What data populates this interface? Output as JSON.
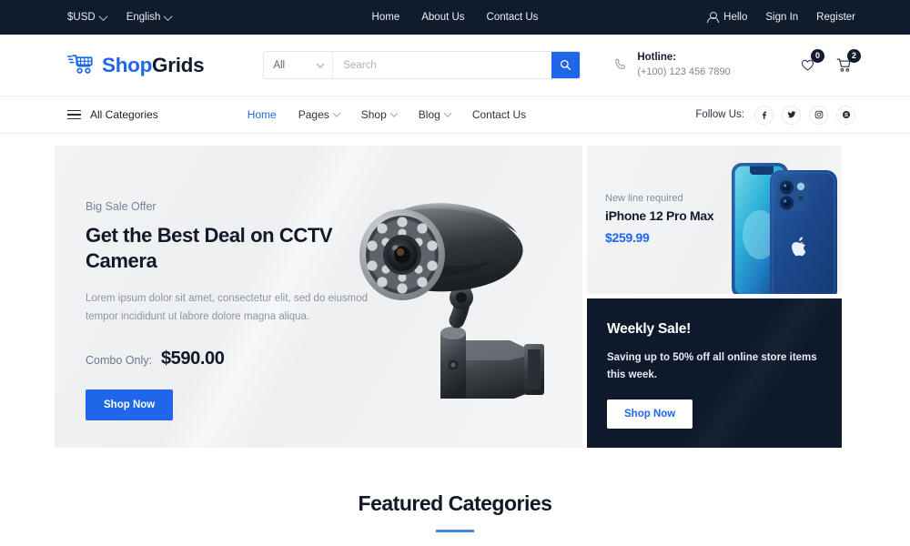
{
  "topbar": {
    "currency": "$USD",
    "language": "English",
    "links": [
      "Home",
      "About Us",
      "Contact Us"
    ],
    "greeting": "Hello",
    "sign_in": "Sign In",
    "register": "Register",
    "user_icon": "user-icon"
  },
  "header": {
    "logo": {
      "part_blue": "Shop",
      "part_dark": "Grids",
      "icon": "shopping-cart-icon"
    },
    "search": {
      "category_selected": "All",
      "placeholder": "Search",
      "value": "",
      "button_icon": "search-icon"
    },
    "hotline": {
      "icon": "phone-icon",
      "label": "Hotline:",
      "number": "(+100) 123 456 7890"
    },
    "wishlist": {
      "icon": "heart-icon",
      "count": "0"
    },
    "cart": {
      "icon": "cart-icon",
      "count": "2"
    }
  },
  "nav": {
    "all_categories": "All Categories",
    "burger_icon": "hamburger-icon",
    "menu": [
      {
        "label": "Home",
        "has_dropdown": false,
        "active": true
      },
      {
        "label": "Pages",
        "has_dropdown": true,
        "active": false
      },
      {
        "label": "Shop",
        "has_dropdown": true,
        "active": false
      },
      {
        "label": "Blog",
        "has_dropdown": true,
        "active": false
      },
      {
        "label": "Contact Us",
        "has_dropdown": false,
        "active": false
      }
    ],
    "follow_label": "Follow Us:",
    "social": [
      "facebook-icon",
      "twitter-icon",
      "instagram-icon",
      "skype-icon"
    ]
  },
  "hero": {
    "eyebrow": "Big Sale Offer",
    "title": "Get the Best Deal on CCTV Camera",
    "description": "Lorem ipsum dolor sit amet, consectetur elit, sed do eiusmod tempor incididunt ut labore dolore magna aliqua.",
    "price_label": "Combo Only:",
    "price": "$590.00",
    "cta": "Shop Now",
    "product_image": "cctv-camera-image"
  },
  "promo_phone": {
    "eyebrow": "New line required",
    "title": "iPhone 12 Pro Max",
    "price": "$259.99",
    "product_image": "iphone-12-pro-max-image"
  },
  "promo_sale": {
    "title": "Weekly Sale!",
    "description": "Saving up to 50% off all online store items this week.",
    "cta": "Shop Now"
  },
  "featured": {
    "title": "Featured Categories"
  },
  "colors": {
    "accent_blue": "#1f66e8",
    "dark_navy": "#0e1a2b",
    "topbar_bg": "#101b2c",
    "text_dark": "#121828",
    "muted": "#8d94a3",
    "rule_blue": "#4a84ea"
  }
}
